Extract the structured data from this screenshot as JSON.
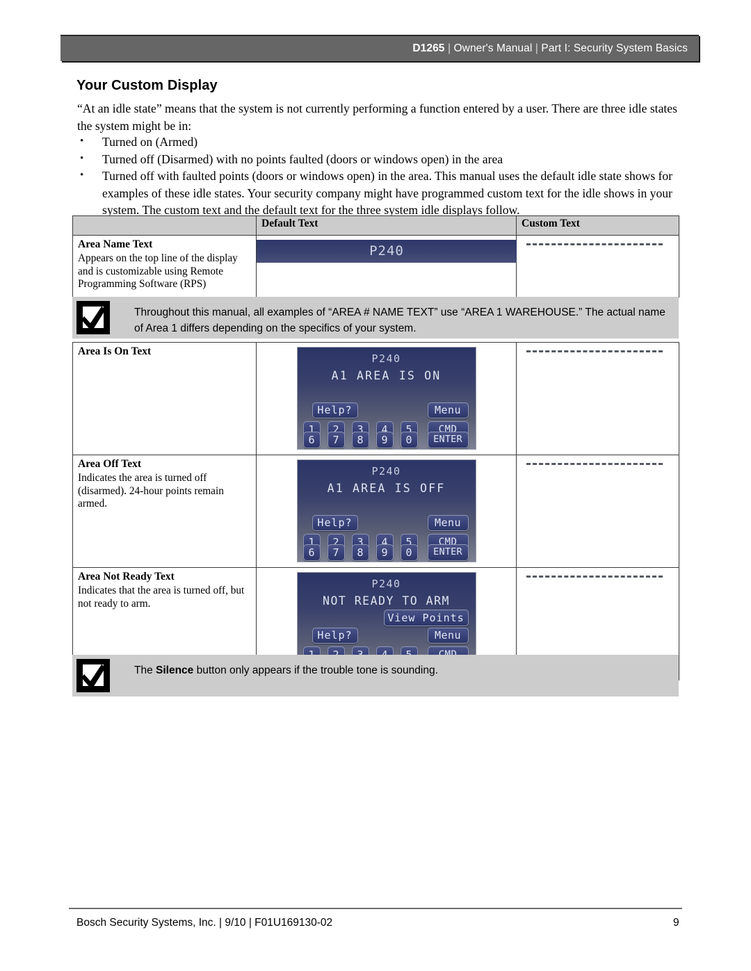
{
  "header": {
    "model": "D1265",
    "separator": "|",
    "part1": "Owner's Manual",
    "part2": "Part I: Security System Basics"
  },
  "page_title": "Your Custom Display",
  "intro": {
    "paragraph": "“At an idle state” means that the system is not currently performing a function entered by a user. There are three idle states the system might be in:",
    "bullets": [
      "Turned on (Armed)",
      "Turned off (Disarmed) with no points faulted (doors or windows open) in the area",
      "Turned off with faulted points (doors or windows open) in the area. This manual uses the default idle state shows for examples of these idle states. Your security company might have programmed custom text for the idle shows in your system. The custom text and the default text for the three system idle displays follow."
    ],
    "bullet_marker": "•"
  },
  "table": {
    "headers": {
      "blank": "",
      "default_text": "Default Text",
      "custom_text": "Custom Text"
    },
    "rows": [
      {
        "label": "Area Name Text",
        "description": "Appears on the top line of the display and is customizable using Remote Programming Software (RPS)",
        "display": {
          "type": "banner",
          "title": "P240"
        },
        "custom": "dashed-line"
      },
      {
        "label": "Area Is On Text",
        "description": "",
        "display": {
          "type": "keypad",
          "line1": "P240",
          "line2": "A1 AREA IS ON",
          "extra_button": null
        },
        "custom": "dashed-line"
      },
      {
        "label": "Area Off Text",
        "description": "Indicates the area is turned off (disarmed). 24-hour points remain armed.",
        "display": {
          "type": "keypad",
          "line1": "P240",
          "line2": "A1 AREA IS OFF",
          "extra_button": null
        },
        "custom": "dashed-line"
      },
      {
        "label": "Area Not Ready Text",
        "description": "Indicates that the area is turned off, but not ready to arm.",
        "display": {
          "type": "keypad",
          "line1": "P240",
          "line2": "NOT READY TO ARM",
          "extra_button": "View Points"
        },
        "custom": "dashed-line"
      }
    ]
  },
  "keypad_buttons": {
    "help": "Help?",
    "menu": "Menu",
    "cmd": "CMD",
    "enter": "ENTER",
    "view_points": "View Points",
    "numbers_row1": [
      "1",
      "2",
      "3",
      "4",
      "5"
    ],
    "numbers_row2": [
      "6",
      "7",
      "8",
      "9",
      "0"
    ]
  },
  "notices": [
    {
      "icon": "checkmark-box-icon",
      "text_plain": "Throughout this manual, all examples of “AREA # NAME TEXT” use “AREA 1 WAREHOUSE.” The actual name of Area 1 differs depending on the specifics of your system."
    },
    {
      "icon": "checkmark-box-icon",
      "text_before": "The ",
      "text_bold": "Silence",
      "text_after": " button only appears if the trouble tone is sounding."
    }
  ],
  "footer": {
    "left": "Bosch Security Systems, Inc. | 9/10 | F01U169130-02",
    "page_number": "9"
  },
  "colors": {
    "header_bar": "#666666",
    "notice_bg": "#cccccc",
    "table_header_bg": "#cccccc",
    "display_blue": "#2e3869",
    "dash_line": "#555a63"
  }
}
